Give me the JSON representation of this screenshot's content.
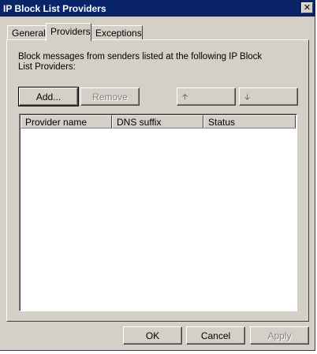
{
  "window": {
    "title": "IP Block List Providers",
    "close_glyph": "✕"
  },
  "tabs": [
    {
      "label": "General"
    },
    {
      "label": "Providers",
      "active": true
    },
    {
      "label": "Exceptions"
    }
  ],
  "description": "Block messages from senders listed at the following IP Block List Providers:",
  "buttons": {
    "add": "Add...",
    "remove": "Remove",
    "move_up_icon": "arrow-up-icon",
    "move_down_icon": "arrow-down-icon",
    "up_glyph": "🡡",
    "down_glyph": "🡣"
  },
  "table": {
    "columns": [
      "Provider name",
      "DNS suffix",
      "Status"
    ],
    "rows": []
  },
  "footer": {
    "ok": "OK",
    "cancel": "Cancel",
    "apply": "Apply"
  }
}
